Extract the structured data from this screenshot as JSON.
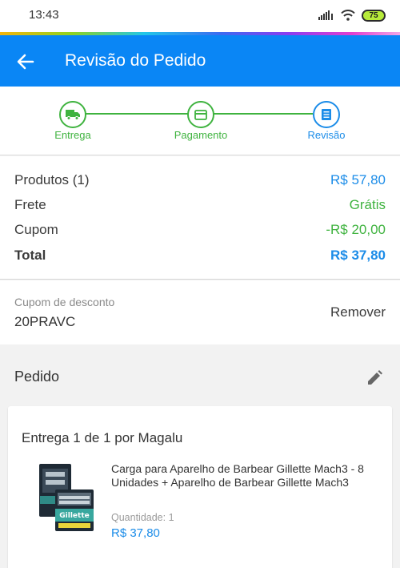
{
  "status_bar": {
    "time": "13:43",
    "battery": "75",
    "icons": [
      "signal-icon",
      "wifi-icon",
      "battery-icon"
    ]
  },
  "header": {
    "title": "Revisão do Pedido",
    "back_icon": "arrow-left-icon",
    "background_color": "#0a86f5"
  },
  "stepper": {
    "steps": [
      {
        "label": "Entrega",
        "icon": "truck-icon",
        "state": "done"
      },
      {
        "label": "Pagamento",
        "icon": "card-icon",
        "state": "done"
      },
      {
        "label": "Revisão",
        "icon": "document-icon",
        "state": "current"
      }
    ],
    "done_color": "#3fb33f",
    "current_color": "#1b8ce8"
  },
  "summary": {
    "products_label": "Produtos (1)",
    "products_value": "R$ 57,80",
    "shipping_label": "Frete",
    "shipping_value": "Grátis",
    "coupon_label": "Cupom",
    "coupon_value": "-R$ 20,00",
    "total_label": "Total",
    "total_value": "R$ 37,80"
  },
  "coupon": {
    "label": "Cupom de desconto",
    "code": "20PRAVC",
    "remove_label": "Remover"
  },
  "order": {
    "title": "Pedido",
    "edit_icon": "pencil-icon",
    "delivery_heading": "Entrega 1 de 1 por Magalu",
    "item": {
      "name": "Carga para Aparelho de Barbear Gillette Mach3 - 8 Unidades + Aparelho de Barbear Gillette Mach3",
      "quantity": "Quantidade:  1",
      "price": "R$ 37,80",
      "image_brand": "Gillette"
    }
  }
}
